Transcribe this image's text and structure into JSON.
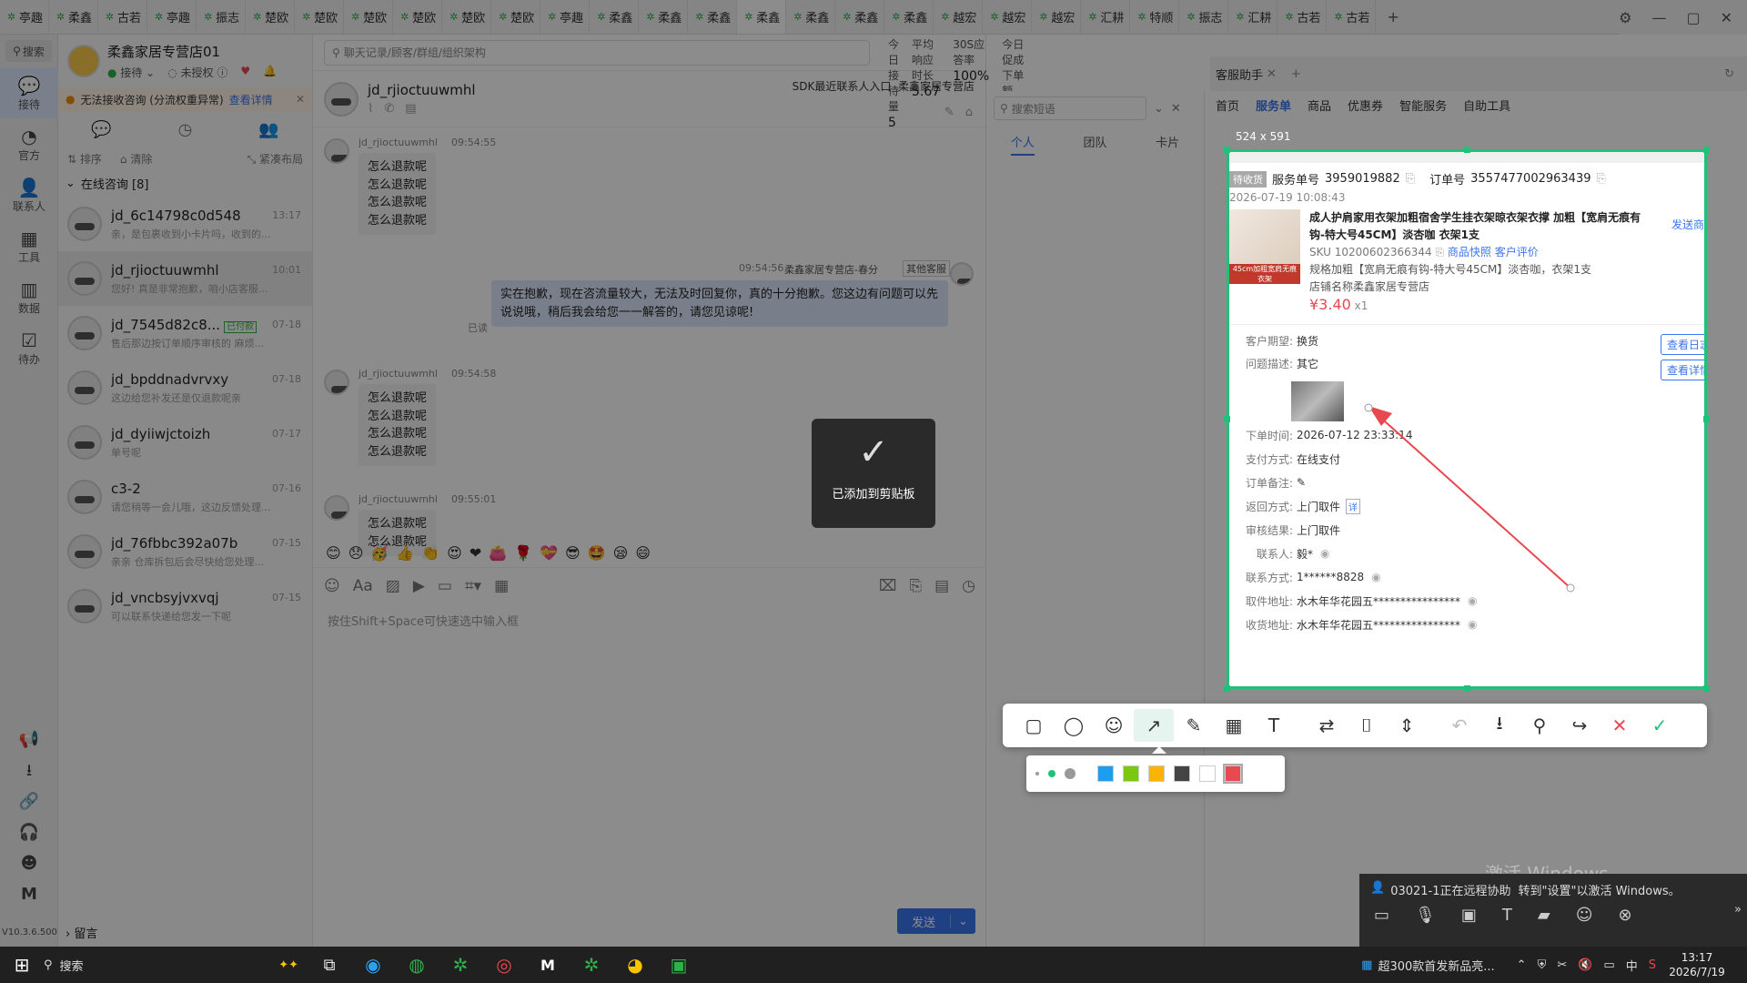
{
  "tabs": [
    "亭趣",
    "柔鑫",
    "古若",
    "亭趣",
    "振志",
    "楚欧",
    "楚欧",
    "楚欧",
    "楚欧",
    "楚欧",
    "楚欧",
    "亭趣",
    "柔鑫",
    "柔鑫",
    "柔鑫",
    "柔鑫",
    "柔鑫",
    "柔鑫",
    "柔鑫",
    "越宏",
    "越宏",
    "越宏",
    "汇耕",
    "特顺",
    "振志",
    "汇耕",
    "古若",
    "古若"
  ],
  "tab_add": "+",
  "sidebar": {
    "search": "搜索",
    "items": [
      {
        "label": "接待",
        "icon": "chat-icon"
      },
      {
        "label": "官方",
        "icon": "official-icon"
      },
      {
        "label": "联系人",
        "icon": "contact-icon"
      },
      {
        "label": "工具",
        "icon": "tools-icon"
      },
      {
        "label": "数据",
        "icon": "data-icon"
      },
      {
        "label": "待办",
        "icon": "todo-icon"
      }
    ],
    "version": "V10.3.6.500"
  },
  "shop": {
    "name": "柔鑫家居专营店01",
    "status1": "接待",
    "status2": "未授权"
  },
  "alert": {
    "text": "无法接收咨询 (分流权重异常)",
    "link": "查看详情"
  },
  "conv_tools": {
    "sort": "排序",
    "clear": "清除",
    "layout": "紧凑布局"
  },
  "online_group": "在线咨询 [8]",
  "conversations": [
    {
      "name": "jd_6c14798c0d548",
      "msg": "亲，是包裹收到小卡片吗，收到的...",
      "time": "13:17",
      "badge": ""
    },
    {
      "name": "jd_rjioctuuwmhl",
      "msg": "您好! 真是非常抱歉，咱小店客服...",
      "time": "10:01",
      "badge": ""
    },
    {
      "name": "jd_7545d82c8...",
      "msg": "售后那边按订单顺序审核的 麻烦...",
      "time": "07-18",
      "badge": "已付款"
    },
    {
      "name": "jd_bpddnadvrvxy",
      "msg": "这边给您补发还是仅退款呢亲",
      "time": "07-18",
      "badge": ""
    },
    {
      "name": "jd_dyiiwjctoizh",
      "msg": "单号呢",
      "time": "07-17",
      "badge": ""
    },
    {
      "name": "c3-2",
      "msg": "请您稍等一会儿哦，这边反馈处理...",
      "time": "07-16",
      "badge": ""
    },
    {
      "name": "jd_76fbbc392a07b",
      "msg": "亲亲 仓库拆包后会尽快给您处理...",
      "time": "07-15",
      "badge": ""
    },
    {
      "name": "jd_vncbsyjvxvqj",
      "msg": "可以联系快递给您发一下呢",
      "time": "07-15",
      "badge": ""
    }
  ],
  "leave_msg": "留言",
  "top_search": "聊天记录/顾客/群组/组织架构",
  "stats": [
    {
      "label": "今日接待量",
      "value": "5"
    },
    {
      "label": "平均响应时长",
      "value": "5.67"
    },
    {
      "label": "30S应答率",
      "value": "100%"
    },
    {
      "label": "今日促成下单额",
      "value": "0.00"
    }
  ],
  "chat": {
    "title": "jd_rjioctuuwmhl",
    "sdk": "SDK最近联系人入口",
    "shop": "柔鑫家居专营店",
    "input_hint": "按住Shift+Space可快速选中输入框",
    "send": "发送",
    "toast": "已添加到剪贴板"
  },
  "messages": [
    {
      "sender": "jd_rjioctuuwmhl",
      "time": "09:54:55",
      "lines": [
        "怎么退款呢",
        "怎么退款呢",
        "怎么退款呢",
        "怎么退款呢"
      ]
    },
    {
      "sender": "柔鑫家居专营店-春分",
      "time": "09:54:56",
      "tag": "其他客服",
      "text": "实在抱歉，现在咨流量较大，无法及时回复你，真的十分抱歉。您这边有问题可以先说说哦，稍后我会给您一一解答的，请您见谅呢!",
      "read": "已读"
    },
    {
      "sender": "jd_rjioctuuwmhl",
      "time": "09:54:58",
      "lines": [
        "怎么退款呢",
        "怎么退款呢",
        "怎么退款呢",
        "怎么退款呢"
      ]
    },
    {
      "sender": "jd_rjioctuuwmhl",
      "time": "09:55:01",
      "lines": [
        "怎么退款呢",
        "怎么退款呢"
      ]
    }
  ],
  "emoji_row": [
    "😊",
    "😞",
    "🥳",
    "👍",
    "👏",
    "😍",
    "❤",
    "👛",
    "🌹",
    "💝",
    "😎",
    "🤩",
    "😪",
    "😄"
  ],
  "quick": {
    "search": "搜索短语",
    "tabs": [
      "个人",
      "团队",
      "卡片"
    ]
  },
  "assistant": {
    "title": "客服助手",
    "tabs": [
      "首页",
      "服务单",
      "商品",
      "优惠券",
      "智能服务",
      "自助工具"
    ],
    "active": "服务单"
  },
  "screenshot": {
    "size": "524 x 591",
    "status": "待收货",
    "service_no_label": "服务单号",
    "service_no": "3959019882",
    "order_no_label": "订单号",
    "order_no": "3557477002963439",
    "datetime": "2026-07-19 10:08:43",
    "product": "成人护肩家用衣架加粗宿舍学生挂衣架晾衣架衣撑 加粗【宽肩无痕有钩-特大号45CM】淡杏咖 衣架1支",
    "sku": "SKU 10200602366344",
    "snapshot": "商品快照",
    "review": "客户评价",
    "spec": "规格加粗【宽肩无痕有钩-特大号45CM】淡杏咖，衣架1支",
    "store": "店铺名称柔鑫家居专营店",
    "price": "¥3.40",
    "qty": "x1",
    "send_product": "发送商品",
    "view_log": "查看日志",
    "view_detail": "查看详情",
    "rows": [
      {
        "label": "客户期望:",
        "value": "换货"
      },
      {
        "label": "问题描述:",
        "value": "其它"
      },
      {
        "label": "下单时间:",
        "value": "2026-07-12 23:33:14"
      },
      {
        "label": "支付方式:",
        "value": "在线支付"
      },
      {
        "label": "订单备注:",
        "value": "✎"
      },
      {
        "label": "返回方式:",
        "value": "上门取件"
      },
      {
        "label": "审核结果:",
        "value": "上门取件"
      },
      {
        "label": "联系人:",
        "value": "毅*"
      },
      {
        "label": "联系方式:",
        "value": "1******8828"
      },
      {
        "label": "取件地址:",
        "value": "水木年华花园五****************"
      },
      {
        "label": "收货地址:",
        "value": "水木年华花园五****************"
      }
    ],
    "detail_tag": "详",
    "thumb_caption": "45cm加粗宽肩无痕衣架"
  },
  "tools": [
    "rect-icon",
    "circle-icon",
    "emoji-icon",
    "arrow-icon",
    "pen-icon",
    "mosaic-icon",
    "text-icon",
    "translate-icon",
    "ocr-icon",
    "scroll-icon",
    "undo-icon",
    "save-icon",
    "pin-icon",
    "share-icon",
    "close-icon",
    "confirm-icon"
  ],
  "colors": {
    "accent": "#1ec27a",
    "arrow": "#e8484f",
    "swatches": [
      "#1e9cf0",
      "#7ac80f",
      "#f8b400",
      "#444444",
      "#ffffff",
      "#e8484f"
    ]
  },
  "remote": {
    "text": "03021-1正在远程协助",
    "activate_title": "激活 Windows",
    "activate_sub": "转到\"设置\"以激活 Windows。"
  },
  "taskbar": {
    "search": "搜索",
    "news": "超300款首发新品亮...",
    "ime": "中",
    "time": "13:17",
    "date": "2026/7/19"
  }
}
